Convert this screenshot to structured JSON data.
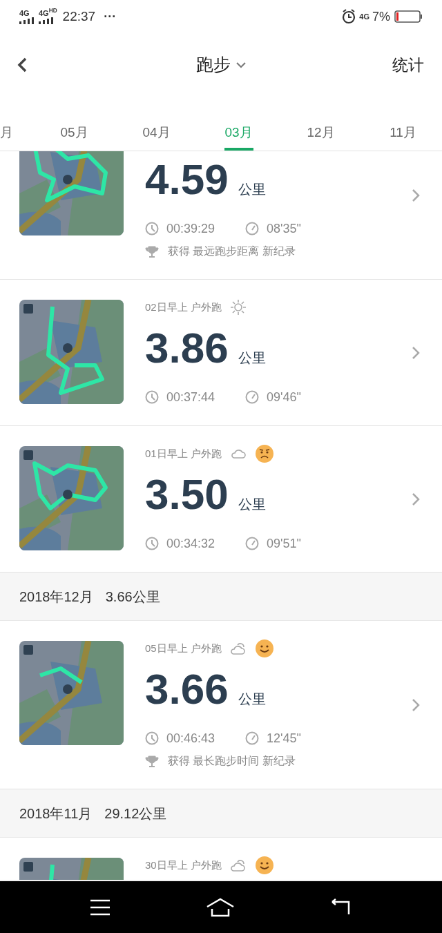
{
  "status_bar": {
    "signals": [
      "4G",
      "4G$^{HD}$"
    ],
    "time": "22:37",
    "more": "···",
    "network": "4G",
    "battery_text": "7%"
  },
  "header": {
    "title": "跑步",
    "action": "统计"
  },
  "month_tabs": [
    {
      "label": "月",
      "selected": false
    },
    {
      "label": "05月",
      "selected": false
    },
    {
      "label": "04月",
      "selected": false
    },
    {
      "label": "03月",
      "selected": true
    },
    {
      "label": "12月",
      "selected": false
    },
    {
      "label": "11月",
      "selected": false
    }
  ],
  "list": [
    {
      "kind": "run",
      "distance": "4.59",
      "unit": "公里",
      "duration": "00:39:29",
      "pace": "08'35\"",
      "record": "获得 最远跑步距离 新纪录"
    },
    {
      "kind": "run",
      "meta": "02日早上 户外跑",
      "icons": [
        {
          "kind": "sun"
        }
      ],
      "distance": "3.86",
      "unit": "公里",
      "duration": "00:37:44",
      "pace": "09'46\""
    },
    {
      "kind": "run",
      "meta": "01日早上 户外跑",
      "icons": [
        {
          "kind": "cloud"
        },
        {
          "kind": "sad"
        }
      ],
      "distance": "3.50",
      "unit": "公里",
      "duration": "00:34:32",
      "pace": "09'51\""
    },
    {
      "kind": "month",
      "label": "2018年12月",
      "total": "3.66公里"
    },
    {
      "kind": "run",
      "meta": "05日早上 户外跑",
      "icons": [
        {
          "kind": "partly-cloudy"
        },
        {
          "kind": "happy"
        }
      ],
      "distance": "3.66",
      "unit": "公里",
      "duration": "00:46:43",
      "pace": "12'45\"",
      "record": "获得 最长跑步时间 新纪录"
    },
    {
      "kind": "month",
      "label": "2018年11月",
      "total": "29.12公里"
    },
    {
      "kind": "run",
      "meta": "30日早上 户外跑",
      "icons": [
        {
          "kind": "partly-cloudy"
        },
        {
          "kind": "happy"
        }
      ]
    }
  ]
}
